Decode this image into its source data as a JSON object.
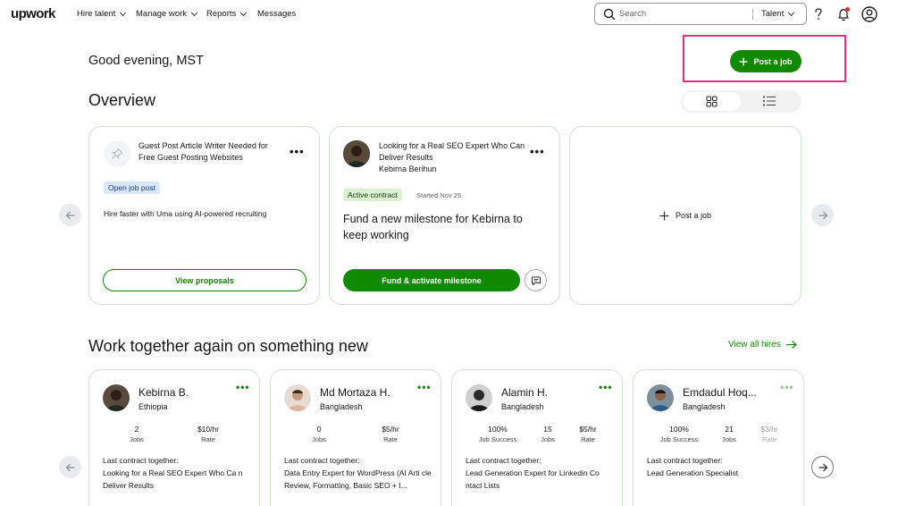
{
  "nav": {
    "logo": "upwork",
    "items": [
      {
        "label": "Hire talent",
        "has_menu": true
      },
      {
        "label": "Manage work",
        "has_menu": true
      },
      {
        "label": "Reports",
        "has_menu": true
      },
      {
        "label": "Messages",
        "has_menu": false
      }
    ],
    "search_placeholder": "Search",
    "search_scope": "Talent"
  },
  "header": {
    "greeting": "Good evening, MST",
    "post_job_label": "Post a job"
  },
  "overview": {
    "title": "Overview",
    "cards": [
      {
        "title": "Guest Post Article Writer Needed for Free Guest Posting Websites",
        "status": "Open job post",
        "body": "Hire faster with Uma using AI-powered recruiting",
        "action": "View proposals"
      },
      {
        "title": "Looking for a Real SEO Expert Who Can Deliver Results",
        "person": "Kebirna Berihun",
        "status": "Active contract",
        "started": "Started Nov 25",
        "headline": "Fund a new milestone for Kebirna to keep working",
        "action": "Fund & activate milestone"
      }
    ],
    "add_card_label": "Post a job"
  },
  "work_again": {
    "title": "Work together again on something new",
    "view_all": "View all hires",
    "freelancers": [
      {
        "name": "Kebirna B.",
        "country": "Ethiopia",
        "stats": [
          {
            "value": "2",
            "label": "Jobs"
          },
          {
            "value": "$10/hr",
            "label": "Rate"
          }
        ],
        "last_label": "Last contract together:",
        "last_contract": "Looking for a Real SEO Expert Who Ca n Deliver Results"
      },
      {
        "name": "Md Mortaza H.",
        "country": "Bangladesh",
        "stats": [
          {
            "value": "0",
            "label": "Jobs"
          },
          {
            "value": "$5/hr",
            "label": "Rate"
          }
        ],
        "last_label": "Last contract together:",
        "last_contract": "Data Entry Expert for WordPress (AI Arti cle Review, Formatting, Basic SEO + I..."
      },
      {
        "name": "Alamin H.",
        "country": "Bangladesh",
        "stats": [
          {
            "value": "100%",
            "label": "Job Success"
          },
          {
            "value": "15",
            "label": "Jobs"
          },
          {
            "value": "$5/hr",
            "label": "Rate"
          }
        ],
        "last_label": "Last contract together:",
        "last_contract": "Lead Generation Expert for Linkedin Co ntact Lists"
      },
      {
        "name": "Emdadul Hoq...",
        "country": "Bangladesh",
        "stats": [
          {
            "value": "100%",
            "label": "Job Success"
          },
          {
            "value": "21",
            "label": "Jobs"
          },
          {
            "value": "$3/hr",
            "label": "Rate"
          }
        ],
        "last_label": "Last contract together:",
        "last_contract": "Lead Generation Specialist"
      }
    ]
  },
  "colors": {
    "brand_green": "#108a00",
    "highlight": "#e0307e",
    "open_pill_bg": "#d9e8fb",
    "active_pill_bg": "#dbf2d2",
    "notification_dot": "#e02f2f"
  }
}
